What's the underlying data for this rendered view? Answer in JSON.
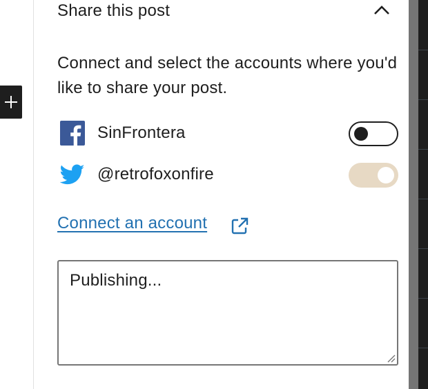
{
  "panel": {
    "title": "Share this post",
    "description": "Connect and select the accounts where you'd like to share your post."
  },
  "accounts": [
    {
      "network": "facebook",
      "icon": "facebook-icon",
      "name": "SinFrontera",
      "enabled": false,
      "color": "#3b5998"
    },
    {
      "network": "twitter",
      "icon": "twitter-icon",
      "name": "@retrofoxonfire",
      "enabled": true,
      "color": "#1da1f2"
    }
  ],
  "connect_link": {
    "label": "Connect an account",
    "color": "#2271b1"
  },
  "message": {
    "value": "Publishing..."
  },
  "colors": {
    "toggle_on": "#e7d9c4",
    "dark": "#1e1e1e"
  }
}
